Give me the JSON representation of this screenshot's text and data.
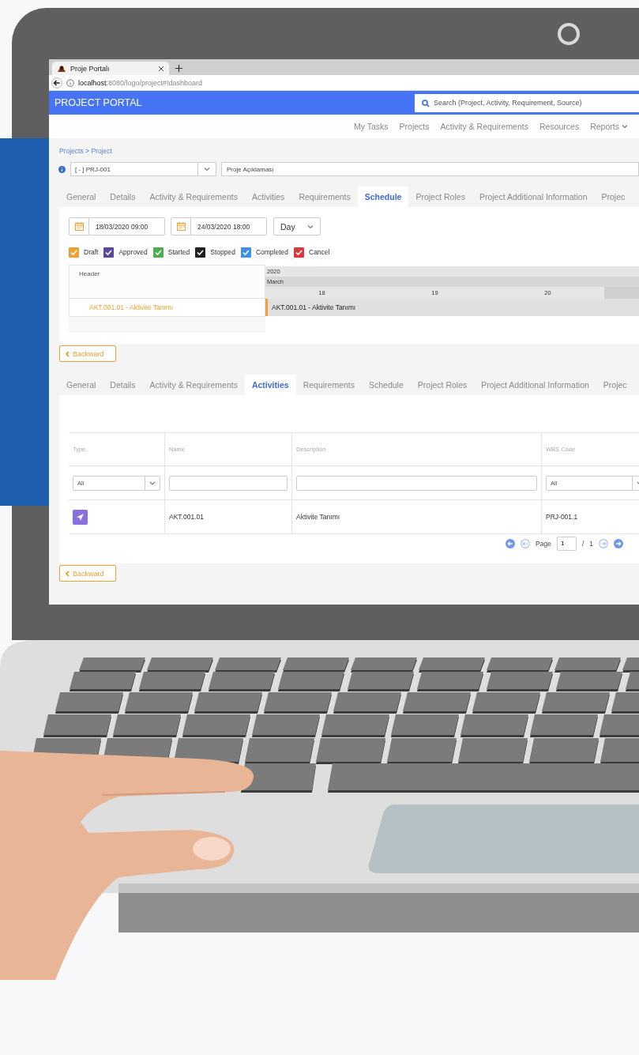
{
  "browser": {
    "tab_title": "Proje Portalı",
    "url": "**localhost**:8080/logo/project#!dashboard"
  },
  "header": {
    "title": "PROJECT PORTAL",
    "search_placeholder": "Search (Project, Activity, Requirement, Source)"
  },
  "nav": [
    {
      "label": "My Tasks",
      "dropdown": false
    },
    {
      "label": "Projects",
      "dropdown": false
    },
    {
      "label": "Activity & Requirements",
      "dropdown": false
    },
    {
      "label": "Resources",
      "dropdown": false
    },
    {
      "label": "Reports",
      "dropdown": true
    }
  ],
  "breadcrumb": "Projects > Project",
  "project": {
    "code": "[ - ] PRJ-001",
    "description": "Proje Açıklaması"
  },
  "schedule": {
    "tabs": [
      {
        "label": "General",
        "selected": false
      },
      {
        "label": "Details",
        "selected": false
      },
      {
        "label": "Activity & Requirements",
        "selected": false
      },
      {
        "label": "Activities",
        "selected": false
      },
      {
        "label": "Requirements",
        "selected": false
      },
      {
        "label": "Schedule",
        "selected": true
      },
      {
        "label": "Project Roles",
        "selected": false
      },
      {
        "label": "Project Additional Information",
        "selected": false
      },
      {
        "label": "Projec",
        "selected": false
      }
    ],
    "start": "18/03/2020 09:00",
    "end": "24/03/2020 18:00",
    "scale": "Day",
    "legend": [
      {
        "label": "Draft",
        "color": "#f0a033"
      },
      {
        "label": "Approved",
        "color": "#5c469c"
      },
      {
        "label": "Started",
        "color": "#4cae4f"
      },
      {
        "label": "Stopped",
        "color": "#222222"
      },
      {
        "label": "Completed",
        "color": "#3d8fe8"
      },
      {
        "label": "Cancel",
        "color": "#d93a3f"
      }
    ],
    "gantt": {
      "header": "Header",
      "year": "2020",
      "month": "March",
      "days": [
        "18",
        "19",
        "20"
      ],
      "tasks": [
        {
          "label": "AKT.001.01 - Aktivite Tanımı",
          "bar_label": "AKT.001.01 - Aktivite Tanımı",
          "color": "#f0a033"
        }
      ]
    },
    "back_button": "Backward"
  },
  "activities": {
    "tabs": [
      {
        "label": "General",
        "selected": false
      },
      {
        "label": "Details",
        "selected": false
      },
      {
        "label": "Activity & Requirements",
        "selected": false
      },
      {
        "label": "Activities",
        "selected": true
      },
      {
        "label": "Requirements",
        "selected": false
      },
      {
        "label": "Schedule",
        "selected": false
      },
      {
        "label": "Project Roles",
        "selected": false
      },
      {
        "label": "Project Additional Information",
        "selected": false
      },
      {
        "label": "Projec",
        "selected": false
      }
    ],
    "columns": [
      "Type",
      "Name",
      "Description",
      "WBS Code"
    ],
    "filters": [
      {
        "kind": "select",
        "value": "All"
      },
      {
        "kind": "text"
      },
      {
        "kind": "text"
      },
      {
        "kind": "select",
        "value": "All"
      }
    ],
    "rows": [
      {
        "color": "#8a6fe0",
        "name": "AKT.001.01",
        "description": "Aktivite Tanımı",
        "wbs_code": "PRJ-001.1"
      }
    ],
    "pager": {
      "label": "Page",
      "page": "1",
      "separator": "/",
      "total": "1"
    },
    "back_button": "Backward"
  }
}
